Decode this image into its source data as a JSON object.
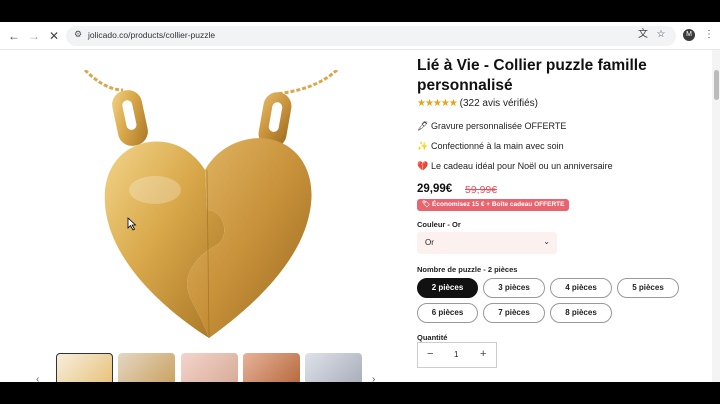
{
  "browser": {
    "url": "jolicado.co/products/collier-puzzle",
    "back_icon": "arrow-left-icon",
    "forward_icon": "arrow-right-icon",
    "close_icon": "close-icon",
    "profile_initial": "M"
  },
  "product": {
    "title": "Lié à Vie - Collier puzzle famille personnalisé",
    "rating_stars": "★★★★★",
    "rating_value": 4.5,
    "reviews": "(322 avis vérifiés)",
    "features": [
      {
        "icon": "🖋",
        "text": "Gravure personnalisée OFFERTE"
      },
      {
        "icon": "✨",
        "text": "Confectionné à la main avec soin"
      },
      {
        "icon": "💔",
        "text": "Le cadeau idéal pour Noël ou un anniversaire"
      }
    ],
    "price": "29,99€",
    "old_price": "59,99€",
    "badge": "🏷 Économisez 15 € + Boîte cadeau OFFERTE",
    "color_label": "Couleur - Or",
    "color_value": "Or",
    "puzzle_label": "Nombre de puzzle - 2 pièces",
    "puzzle_options": [
      "2 pièces",
      "3 pièces",
      "4 pièces",
      "5 pièces",
      "6 pièces",
      "7 pièces",
      "8 pièces"
    ],
    "puzzle_selected": "2 pièces",
    "quantity_label": "Quantité",
    "quantity_value": "1",
    "qty_minus": "−",
    "qty_plus": "+"
  },
  "colors": {
    "gold": "#d9a84a",
    "badge": "#e8646f",
    "old_price": "#e05260"
  }
}
